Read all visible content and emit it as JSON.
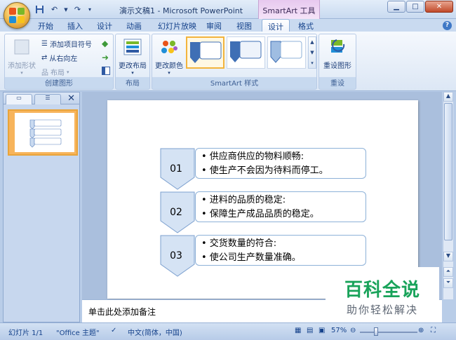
{
  "window": {
    "title": "演示文稿1 - Microsoft PowerPoint",
    "context_tab": "SmartArt 工具",
    "min_icon": "minimize-icon",
    "max_icon": "maximize-icon",
    "close_icon": "close-icon"
  },
  "qat": {
    "save": "save-icon",
    "undo": "undo-icon",
    "redo": "redo-icon"
  },
  "tabs": [
    "开始",
    "插入",
    "设计",
    "动画",
    "幻灯片放映",
    "审阅",
    "视图",
    "设计",
    "格式"
  ],
  "active_tab_index": 7,
  "ribbon": {
    "groups": {
      "create": "创建图形",
      "layout": "布局",
      "style": "SmartArt 样式",
      "reset": "重设"
    },
    "buttons": {
      "add_shape": "添加形状",
      "add_bullet": "添加项目符号",
      "right_to_left": "从右向左",
      "layout_menu": "布局",
      "change_layout": "更改布局",
      "change_colors": "更改颜色",
      "reset_graphic": "重设图形"
    }
  },
  "left_pane": {
    "slide_number": "1"
  },
  "slide": {
    "items": [
      {
        "num": "01",
        "lines": [
          "• 供应商供应的物料顺畅:",
          "• 使生产不会因为待料而停工。"
        ]
      },
      {
        "num": "02",
        "lines": [
          "• 进料的品质的稳定:",
          "• 保障生产成品品质的稳定。"
        ]
      },
      {
        "num": "03",
        "lines": [
          "• 交货数量的符合:",
          "• 使公司生产数量准确。"
        ]
      }
    ]
  },
  "notes": {
    "placeholder": "单击此处添加备注"
  },
  "watermark": {
    "title": "百科全说",
    "subtitle": "助你轻松解决"
  },
  "status": {
    "slide": "幻灯片 1/1",
    "theme": "\"Office 主题\"",
    "language": "中文(简体，中国)",
    "zoom": "57%"
  },
  "colors": {
    "accent_blue": "#4472c4",
    "chevron_fill": "#d5e3f4",
    "chevron_stroke": "#7ca0cf",
    "watermark_green": "#19a35a",
    "selection_orange": "#f3b43c"
  }
}
